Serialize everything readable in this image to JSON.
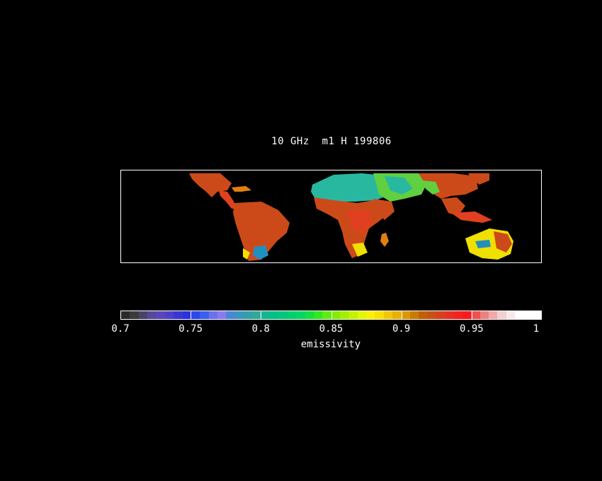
{
  "title": "10 GHz  m1 H 199806",
  "colorbar": {
    "label": "emissivity",
    "ticks": [
      "0.7",
      "0.75",
      "0.8",
      "0.85",
      "0.9",
      "0.95",
      "1"
    ],
    "range": [
      0.7,
      1.0
    ],
    "colors": [
      "#2a2a2a",
      "#3a3a3a",
      "#48426a",
      "#54489a",
      "#5a46b4",
      "#4d40c8",
      "#3a36d6",
      "#2830e0",
      "#2a48ec",
      "#3a60f0",
      "#6a70f0",
      "#8a7af0",
      "#4a86d8",
      "#3a96c0",
      "#30a0aa",
      "#30aa98",
      "#10b88c",
      "#00c088",
      "#00c878",
      "#00d070",
      "#00d860",
      "#10e040",
      "#30e820",
      "#60ec10",
      "#80ee00",
      "#a0f000",
      "#c0f400",
      "#e0f800",
      "#fff000",
      "#f8e000",
      "#f0c800",
      "#e8b000",
      "#dc9600",
      "#cc7a00",
      "#c06000",
      "#c85010",
      "#d84018",
      "#e83020",
      "#f82020",
      "#ff1818",
      "#f05050",
      "#f08080",
      "#f0a8a8",
      "#f0d0d0",
      "#f8e8e8",
      "#ffffff",
      "#ffffff",
      "#ffffff"
    ]
  },
  "map": {
    "colors": {
      "veg": "#cc4a1a",
      "veg_hi": "#e04020",
      "desert": "#28b8a0",
      "desert_dark": "#2090c0",
      "transition": "#60d040",
      "yellow": "#f0e000",
      "orange": "#e08010"
    }
  }
}
